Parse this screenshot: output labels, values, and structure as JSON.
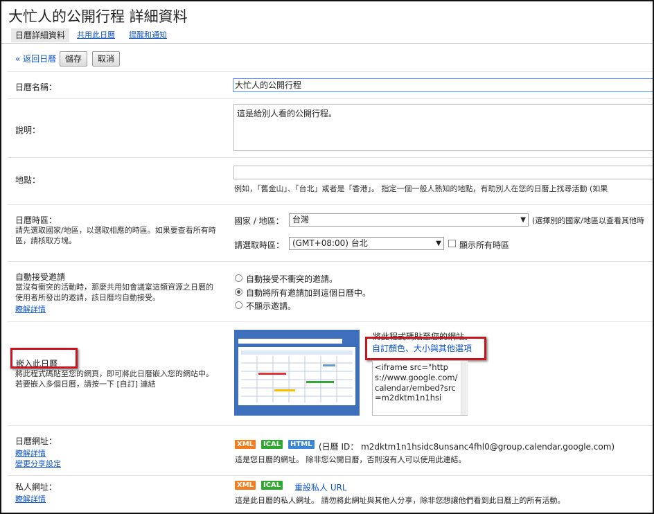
{
  "page": {
    "title": "大忙人的公開行程 詳細資料"
  },
  "tabs": [
    {
      "label": "日曆詳細資料"
    },
    {
      "label": "共用此日曆"
    },
    {
      "label": "提醒和通知"
    }
  ],
  "toolbar": {
    "back_label": "« 返回日曆",
    "save_label": "儲存",
    "cancel_label": "取消"
  },
  "name_row": {
    "label": "日曆名稱：",
    "value": "大忙人的公開行程"
  },
  "desc_row": {
    "label": "說明：",
    "value": "這是給別人看的公開行程。"
  },
  "location_row": {
    "label": "地點：",
    "value": "",
    "hint": "例如，「舊金山」、「台北」或者是「香港」。 指定一個一般人熟知的地點，有助別人在您的日曆上找尋活動 (如果"
  },
  "timezone_row": {
    "label": "日曆時區：",
    "desc": "請先選取國家/地區，以選取相應的時區。如果要查看所有時區，請核取方塊。",
    "country_label": "國家 / 地區：",
    "country_value": "台灣",
    "country_hint": "(選擇別的國家/地區以查看其他時",
    "tz_label": "請選取時區：",
    "tz_value": "(GMT+08:00) 台北",
    "show_all_label": "顯示所有時區"
  },
  "auto_accept_row": {
    "label": "自動接受邀請",
    "desc": "當沒有衝突的活動時，那麼共用如會議室這類資源之日曆的使用者所發出的邀請，該日曆均自動接受。",
    "learn_more": "瞭解詳情",
    "options": [
      {
        "label": "自動接受不衝突的邀請。",
        "checked": false
      },
      {
        "label": "自動將所有邀請加到這個日曆中。",
        "checked": true
      },
      {
        "label": "不顯示邀請。",
        "checked": false
      }
    ]
  },
  "embed_row": {
    "label": "嵌入此日曆",
    "desc": "將此程式碼貼至您的網頁，即可將此日曆嵌入您的網站中。 若要嵌入多個日曆，請按一下 [自訂] 連結",
    "paste_hint": "將此程式碼貼至您的網站。",
    "customize_link": "自訂顏色、大小與其他選項",
    "code": "<iframe src=\"https://www.google.com/calendar/embed?src=m2dktm1n1hsi"
  },
  "address_row": {
    "label": "日曆網址：",
    "learn_more": "瞭解詳情",
    "change_share": "變更分享設定",
    "badges": [
      "XML",
      "ICAL",
      "HTML"
    ],
    "id_text": "(日曆 ID： m2dktm1n1hsidc8unsanc4fhl0@group.calendar.google.com)",
    "desc": "這是您日曆的網址。 除非您公開日曆，否則沒有人可以使用此連結。"
  },
  "private_row": {
    "label": "私人網址：",
    "learn_more": "瞭解詳情",
    "badges": [
      "XML",
      "ICAL"
    ],
    "reset_link": "重設私人 URL",
    "desc": "這是此日曆的私人網址。 請勿將此網址與其他人分享，除非您想讓他們看到此日曆上的所有活動。"
  },
  "colors": {
    "link": "#1155cc",
    "xml": "#f57d1e",
    "ical": "#2fa82f",
    "html": "#3b86d6",
    "highlight": "#c8141c"
  }
}
